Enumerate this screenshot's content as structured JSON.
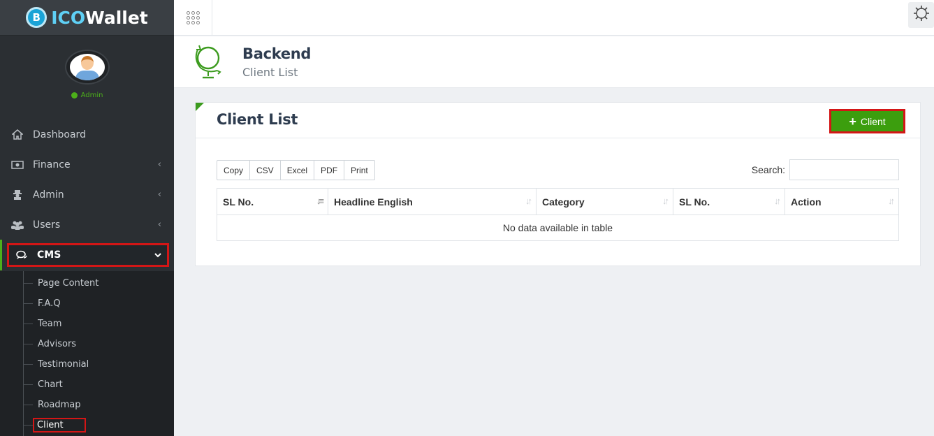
{
  "brand": {
    "coin_glyph": "B",
    "name_part1": "ICO",
    "name_part2": "Wallet"
  },
  "profile": {
    "status_label": "Admin",
    "status_color": "#4caf1a"
  },
  "sidebar": {
    "items": [
      {
        "label": "Dashboard",
        "icon": "home-icon"
      },
      {
        "label": "Finance",
        "icon": "money-icon"
      },
      {
        "label": "Admin",
        "icon": "user-secret-icon"
      },
      {
        "label": "Users",
        "icon": "users-icon"
      },
      {
        "label": "CMS",
        "icon": "comments-icon"
      }
    ],
    "cms_children": [
      "Page Content",
      "F.A.Q",
      "Team",
      "Advisors",
      "Testimonial",
      "Chart",
      "Roadmap",
      "Client"
    ]
  },
  "header": {
    "title": "Backend",
    "subtitle": "Client List"
  },
  "card": {
    "title": "Client List",
    "add_button_label": "Client",
    "export_buttons": [
      "Copy",
      "CSV",
      "Excel",
      "PDF",
      "Print"
    ],
    "search_label": "Search:",
    "search_value": "",
    "columns": [
      "SL No.",
      "Headline English",
      "Category",
      "SL No.",
      "Action"
    ],
    "empty_message": "No data available in table"
  },
  "colors": {
    "accent_green": "#3c9e0e",
    "highlight_red": "#d31616",
    "sidebar_bg": "#2b2f33"
  }
}
